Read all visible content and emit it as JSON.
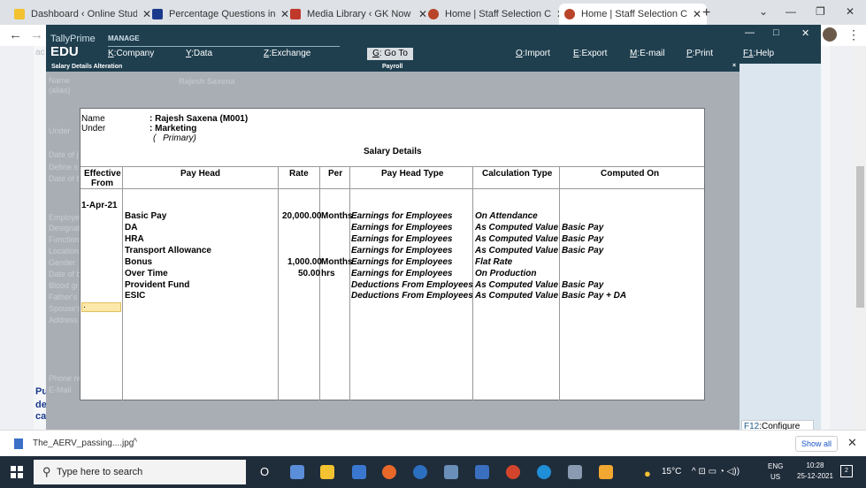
{
  "browser": {
    "tabs": [
      {
        "title": "Dashboard ‹ Online Study Te",
        "color": "#f2c230"
      },
      {
        "title": "Percentage Questions in Hin",
        "color": "#1a3a8c"
      },
      {
        "title": "Media Library ‹ GK Now — W",
        "color": "#c0392b"
      },
      {
        "title": "Home | Staff Selection Comm",
        "color": "#b8442a"
      },
      {
        "title": "Home | Staff Selection Comm",
        "color": "#b8442a"
      }
    ],
    "new_tab": "+",
    "close_glyph": "✕",
    "win_min": "—",
    "win_max": "❐",
    "win_close": "✕",
    "chevron": "⌄",
    "back": "←",
    "forward": "→",
    "kebab": "⋮"
  },
  "site": {
    "labels": [
      "Name",
      "(alias)",
      "Under",
      "Date of j",
      "Define s",
      "Date of b",
      "Employe",
      "Designat",
      "Function",
      "Location",
      "Gender",
      "Date of b",
      "Blood gr",
      "Father's",
      "Spouse's",
      "Address",
      "Phone nu",
      "E-Mail"
    ],
    "blue_text": [
      "Pu",
      "de",
      "ca"
    ],
    "misc": "ac"
  },
  "tally": {
    "logo_top": "TallyPrime",
    "logo_bottom": "EDU",
    "manage": "MANAGE",
    "menu": [
      {
        "key": "K",
        "label": ":Company"
      },
      {
        "key": "Y",
        "label": ":Data"
      },
      {
        "key": "Z",
        "label": ":Exchange"
      },
      {
        "key": "G",
        "label": ": Go To"
      },
      {
        "key": "O",
        "label": ":Import"
      },
      {
        "key": "E",
        "label": ":Export"
      },
      {
        "key": "M",
        "label": ":E-mail"
      },
      {
        "key": "P",
        "label": ":Print"
      },
      {
        "key": "F1",
        "label": ":Help"
      }
    ],
    "win_min": "—",
    "win_max": "□",
    "win_close": "✕",
    "bar_left": "Salary Details  Alteration",
    "bar_center": "Payroll",
    "bar_close": "×",
    "faded_name": "Rajesh Saxena",
    "f12_key": "F12",
    "f12_label": ":Configure"
  },
  "salary": {
    "name_label": "Name",
    "under_label": "Under",
    "name_value": ": Rajesh Saxena  (M001)",
    "under_value": ": Marketing",
    "under_sub": "(  Primary)",
    "heading": "Salary Details",
    "columns": {
      "effective": "Effective",
      "from": "From",
      "pay_head": "Pay Head",
      "rate": "Rate",
      "per": "Per",
      "type": "Pay Head Type",
      "calc": "Calculation Type",
      "computed": "Computed On"
    },
    "effective_date": "1-Apr-21",
    "rows": [
      {
        "head": "Basic Pay",
        "rate": "20,000.00",
        "per": "Months",
        "type": "Earnings for Employees",
        "calc": "On Attendance",
        "computed": ""
      },
      {
        "head": "DA",
        "rate": "",
        "per": "",
        "type": "Earnings for Employees",
        "calc": "As Computed Value",
        "computed": "Basic Pay"
      },
      {
        "head": "HRA",
        "rate": "",
        "per": "",
        "type": "Earnings for Employees",
        "calc": "As Computed Value",
        "computed": "Basic Pay"
      },
      {
        "head": "Transport Allowance",
        "rate": "",
        "per": "",
        "type": "Earnings for Employees",
        "calc": "As Computed Value",
        "computed": "Basic Pay"
      },
      {
        "head": "Bonus",
        "rate": "1,000.00",
        "per": "Months",
        "type": "Earnings for Employees",
        "calc": "Flat Rate",
        "computed": ""
      },
      {
        "head": "Over Time",
        "rate": "50.00",
        "per": "hrs",
        "type": "Earnings for Employees",
        "calc": "On Production",
        "computed": ""
      },
      {
        "head": "Provident Fund",
        "rate": "",
        "per": "",
        "type": "Deductions From Employees",
        "calc": "As Computed Value",
        "computed": "Basic Pay"
      },
      {
        "head": "ESIC",
        "rate": "",
        "per": "",
        "type": "Deductions From Employees",
        "calc": "As Computed Value",
        "computed": "Basic Pay + DA"
      }
    ],
    "cursor_text": "."
  },
  "download": {
    "file": "The_AERV_passing....jpg",
    "chevron": "^",
    "show_all": "Show all",
    "close": "✕"
  },
  "taskbar": {
    "search_placeholder": "Type here to search",
    "search_icon": "⚲",
    "cortana": "O",
    "weather": "15°C",
    "tray_icons": "^  ⊡  ▭  ◔  ◁))",
    "lang1": "ENG",
    "lang2": "US",
    "time": "10:28",
    "date": "25-12-2021",
    "notifications": "2",
    "icons": [
      "#5b8ed8",
      "#f2c230",
      "#3a78d0",
      "#e8682a",
      "#2c6fbe",
      "#6a8fb8",
      "#3a6fc0",
      "#d2452c",
      "#1f8fd8",
      "#8a9ab0",
      "#f2a830"
    ]
  }
}
